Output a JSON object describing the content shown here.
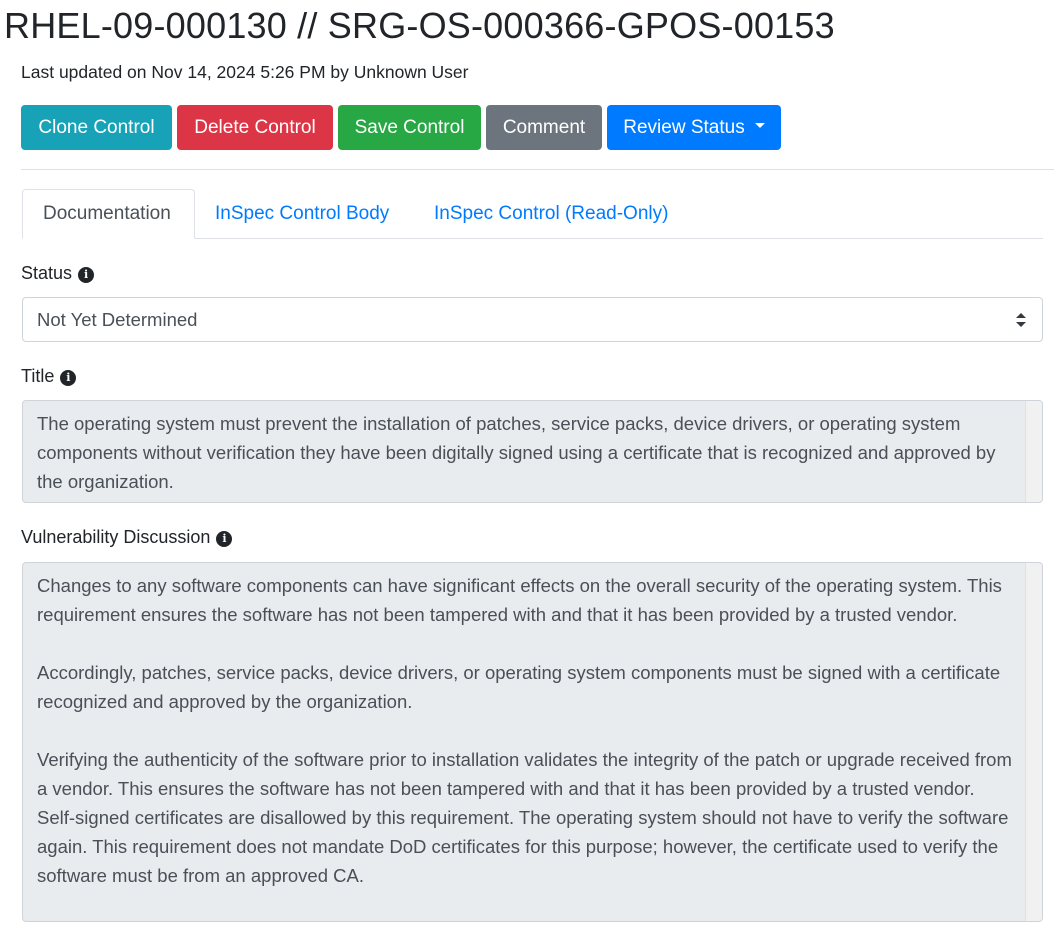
{
  "control": {
    "title": "RHEL-09-000130 // SRG-OS-000366-GPOS-00153",
    "last_updated": "Last updated on Nov 14, 2024 5:26 PM by Unknown User"
  },
  "toolbar": {
    "clone_label": "Clone Control",
    "delete_label": "Delete Control",
    "save_label": "Save Control",
    "comment_label": "Comment",
    "review_status_label": "Review Status"
  },
  "colors": {
    "clone": "#17a2b8",
    "delete": "#dc3545",
    "save": "#28a745",
    "comment": "#6c757d",
    "review": "#007bff",
    "link": "#007bff"
  },
  "tabs": [
    {
      "label": "Documentation",
      "active": true
    },
    {
      "label": "InSpec Control Body",
      "active": false
    },
    {
      "label": "InSpec Control (Read-Only)",
      "active": false
    }
  ],
  "fields": {
    "status": {
      "label": "Status",
      "value": "Not Yet Determined"
    },
    "title": {
      "label": "Title",
      "value": "The operating system must prevent the installation of patches, service packs, device drivers, or operating system components without verification they have been digitally signed using a certificate that is recognized and approved by the organization."
    },
    "vulnerability_discussion": {
      "label": "Vulnerability Discussion",
      "paragraphs": [
        "Changes to any software components can have significant effects on the overall security of the operating system. This requirement ensures the software has not been tampered with and that it has been provided by a trusted vendor.",
        "Accordingly, patches, service packs, device drivers, or operating system components must be signed with a certificate recognized and approved by the organization.",
        "Verifying the authenticity of the software prior to installation validates the integrity of the patch or upgrade received from a vendor. This ensures the software has not been tampered with and that it has been provided by a trusted vendor. Self-signed certificates are disallowed by this requirement. The operating system should not have to verify the software again. This requirement does not mandate DoD certificates for this purpose; however, the certificate used to verify the software must be from an approved CA."
      ]
    }
  },
  "icons": {
    "info": "info-circle-icon",
    "caret": "caret-down-icon",
    "select_arrows": "select-arrows-icon"
  }
}
